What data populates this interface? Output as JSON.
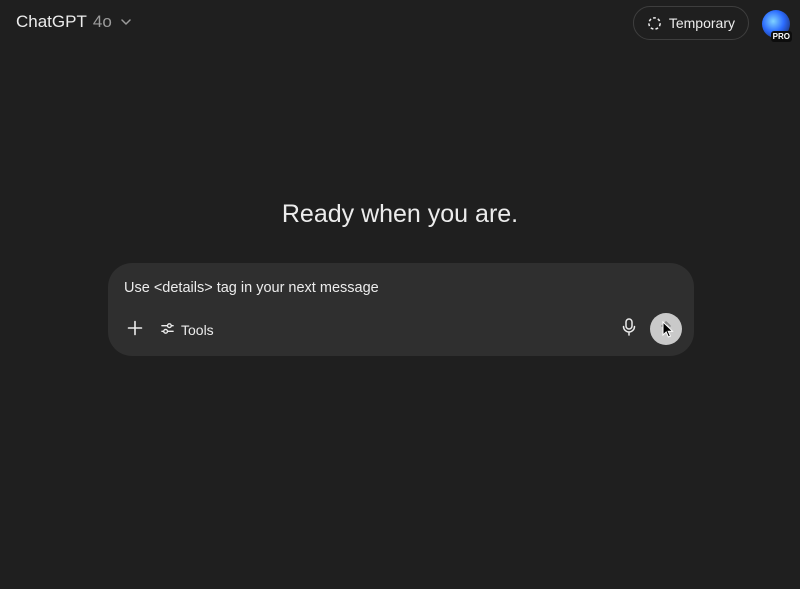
{
  "header": {
    "model_name": "ChatGPT",
    "model_version": "4o",
    "temporary_label": "Temporary",
    "avatar_badge": "PRO"
  },
  "main": {
    "heading": "Ready when you are."
  },
  "composer": {
    "input_value": "Use <details> tag in your next message",
    "tools_label": "Tools"
  },
  "icons": {
    "model_chevron": "chevron-down-icon",
    "temporary": "dashed-circle-icon",
    "add": "plus-icon",
    "tools": "sliders-icon",
    "voice": "microphone-icon",
    "send": "arrow-up-icon",
    "pointer": "mouse-cursor-icon"
  },
  "colors": {
    "background": "#1f1f1f",
    "composer_bg": "#2f2f2f",
    "text": "#ececec",
    "muted": "#9b9b9b",
    "send_bg": "#c9c9c9"
  }
}
